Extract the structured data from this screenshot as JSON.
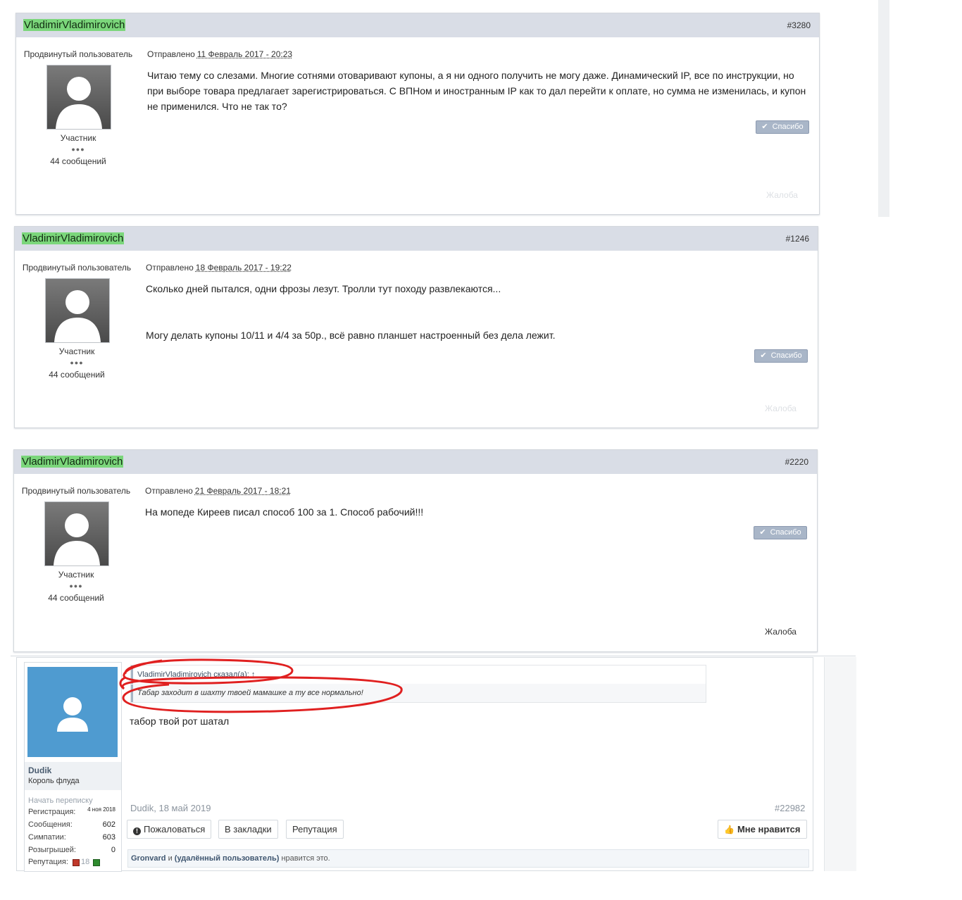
{
  "posts": [
    {
      "username": "VladimirVladimirovich",
      "post_number": "#3280",
      "rank": "Продвинутый пользователь",
      "role": "Участник",
      "dots": "●●●",
      "message_count": "44 сообщений",
      "sent_label": "Отправлено",
      "date": "11 Февраль 2017 - 20:23",
      "body": [
        "Читаю тему со слезами. Многие сотнями отоваривают купоны, а я ни одного получить не могу даже. Динамический IP, все по инструкции, но",
        "при выборе товара предлагает зарегистрироваться. С ВПНом и иностранным IP как то дал перейти к оплате, но сумма не изменилась, и купон",
        "не применился. Что не так то?"
      ],
      "thanks_label": "Спасибо",
      "report_label": "Жалоба"
    },
    {
      "username": "VladimirVladimirovich",
      "post_number": "#1246",
      "rank": "Продвинутый пользователь",
      "role": "Участник",
      "dots": "●●●",
      "message_count": "44 сообщений",
      "sent_label": "Отправлено",
      "date": "18 Февраль 2017 - 19:22",
      "body": [
        "Сколько дней пытался, одни фрозы лезут. Тролли тут походу развлекаются...",
        "",
        "",
        "Могу делать купоны 10/11 и 4/4 за 50р., всё равно планшет настроенный без дела лежит."
      ],
      "thanks_label": "Спасибо",
      "report_label": "Жалоба"
    },
    {
      "username": "VladimirVladimirovich",
      "post_number": "#2220",
      "rank": "Продвинутый пользователь",
      "role": "Участник",
      "dots": "●●●",
      "message_count": "44 сообщений",
      "sent_label": "Отправлено",
      "date": "21 Февраль 2017 - 18:21",
      "body": [
        "На мопеде Киреев писал способ 100 за 1. Способ рабочий!!!"
      ],
      "thanks_label": "Спасибо",
      "report_label": "Жалоба"
    }
  ],
  "reply": {
    "username": "Dudik",
    "title": "Король флуда",
    "start_conversation": "Начать переписку",
    "stats": [
      {
        "label": "Регистрация:",
        "value": "4 ноя 2018"
      },
      {
        "label": "Сообщения:",
        "value": "602"
      },
      {
        "label": "Симпатии:",
        "value": "603"
      },
      {
        "label": "Розыгрышей:",
        "value": "0"
      },
      {
        "label": "Репутация:",
        "value": "18"
      }
    ],
    "quote_header": "VladimirVladimirovich сказал(а): ↑",
    "quote_text": "Табар заходит в шахту твоей мамашке а ту все нормально!",
    "message": "табор твой рот шатал",
    "meta": "Dudik, 18 май 2019",
    "post_id": "#22982",
    "buttons": {
      "report": "Пожаловаться",
      "bookmark": "В закладки",
      "reputation": "Репутация",
      "like": "Мне нравится"
    },
    "likes": {
      "user1": "Gronvard",
      "and": "и",
      "user2": "(удалённый пользователь)",
      "suffix": "нравится это."
    },
    "colors": {
      "avatar_bg": "#4f9bd0",
      "annotation": "#e02020",
      "username_highlight": "#7bd67b"
    }
  }
}
